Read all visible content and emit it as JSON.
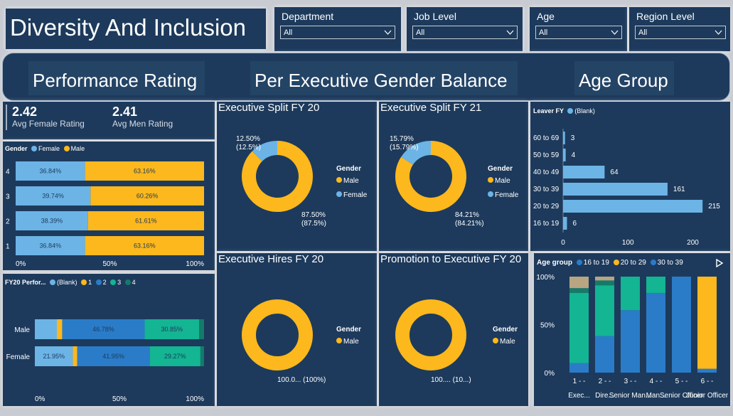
{
  "header": {
    "title": "Diversity And Inclusion"
  },
  "filters": [
    {
      "label": "Department",
      "value": "All"
    },
    {
      "label": "Job Level",
      "value": "All"
    },
    {
      "label": "Age",
      "value": "All"
    },
    {
      "label": "Region Level",
      "value": "All"
    }
  ],
  "nav": {
    "performance": "Performance Rating",
    "gender_balance": "Per Executive Gender Balance",
    "age_group": "Age Group"
  },
  "kpis": {
    "female_value": "2.42",
    "female_label": "Avg Female Rating",
    "male_value": "2.41",
    "male_label": "Avg Men Rating"
  },
  "colors": {
    "female": "#6cb4e6",
    "male": "#fcb81c",
    "blank": "#6cb4e6",
    "r1": "#fcb81c",
    "r2": "#2a7cc8",
    "r3": "#13b592",
    "r4": "#157a6a",
    "age_16_19": "#2a7cc8",
    "age_20_29": "#fcb81c",
    "age_30_39": "#13b592",
    "age_40_49": "#157a6a",
    "age_50_59": "#b8a582"
  },
  "chart_data": [
    {
      "id": "gender_rating",
      "type": "bar",
      "stacked": "100%",
      "orientation": "horizontal",
      "legend_title": "Gender",
      "categories": [
        "4",
        "3",
        "2",
        "1"
      ],
      "series": [
        {
          "name": "Female",
          "values": [
            36.84,
            39.74,
            38.39,
            36.84
          ],
          "labels": [
            "36.84%",
            "39.74%",
            "38.39%",
            "36.84%"
          ]
        },
        {
          "name": "Male",
          "values": [
            63.16,
            60.26,
            61.61,
            63.16
          ],
          "labels": [
            "63.16%",
            "60.26%",
            "61.61%",
            "63.16%"
          ]
        }
      ],
      "xticks": [
        "0%",
        "50%",
        "100%"
      ]
    },
    {
      "id": "fy20_performance",
      "type": "bar",
      "stacked": "100%",
      "orientation": "horizontal",
      "legend_title": "FY20 Perfor...",
      "categories": [
        "Male",
        "Female"
      ],
      "series": [
        {
          "name": "(Blank)",
          "values": [
            12.5,
            21.95
          ],
          "labels": [
            "",
            "21.95%"
          ]
        },
        {
          "name": "1",
          "values": [
            3.0,
            2.5
          ],
          "labels": [
            "",
            ""
          ]
        },
        {
          "name": "2",
          "values": [
            46.78,
            41.95
          ],
          "labels": [
            "46.78%",
            "41.95%"
          ]
        },
        {
          "name": "3",
          "values": [
            30.85,
            29.27
          ],
          "labels": [
            "30.85%",
            "29.27%"
          ]
        },
        {
          "name": "4",
          "values": [
            2.8,
            2.1
          ],
          "labels": [
            "",
            ""
          ]
        }
      ],
      "xticks": [
        "0%",
        "50%",
        "100%"
      ]
    },
    {
      "id": "exec_split_fy20",
      "type": "pie",
      "donut": true,
      "title": "Executive Split FY 20",
      "legend_title": "Gender",
      "legend": [
        "Male",
        "Female"
      ],
      "slices": [
        {
          "name": "Male",
          "value": 87.5,
          "label": "87.50%",
          "label2": "(87.5%)"
        },
        {
          "name": "Female",
          "value": 12.5,
          "label": "12.50%",
          "label2": "(12.5%)"
        }
      ]
    },
    {
      "id": "exec_split_fy21",
      "type": "pie",
      "donut": true,
      "title": "Executive Split FY 21",
      "legend_title": "Gender",
      "legend": [
        "Male",
        "Female"
      ],
      "slices": [
        {
          "name": "Male",
          "value": 84.21,
          "label": "84.21%",
          "label2": "(84.21%)"
        },
        {
          "name": "Female",
          "value": 15.79,
          "label": "15.79%",
          "label2": "(15.79%)"
        }
      ]
    },
    {
      "id": "exec_hires_fy20",
      "type": "pie",
      "donut": true,
      "title": "Executive Hires FY 20",
      "legend_title": "Gender",
      "legend": [
        "Male"
      ],
      "slices": [
        {
          "name": "Male",
          "value": 100,
          "label": "100.0... (100%)"
        }
      ]
    },
    {
      "id": "promotion_exec_fy20",
      "type": "pie",
      "donut": true,
      "title": "Promotion to Executive FY 20",
      "legend_title": "Gender",
      "legend": [
        "Male"
      ],
      "slices": [
        {
          "name": "Male",
          "value": 100,
          "label": "100.... (10...)"
        }
      ]
    },
    {
      "id": "leaver_fy",
      "type": "bar",
      "orientation": "horizontal",
      "legend_title": "Leaver FY",
      "legend": [
        "(Blank)"
      ],
      "categories": [
        "60 to 69",
        "50 to 59",
        "40 to 49",
        "30 to 39",
        "20 to 29",
        "16 to 19"
      ],
      "values": [
        3,
        4,
        64,
        161,
        215,
        6
      ],
      "xlim": [
        0,
        240
      ],
      "xticks": [
        0,
        100,
        200
      ]
    },
    {
      "id": "age_group",
      "type": "bar",
      "stacked": "100%",
      "legend_title": "Age group",
      "legend": [
        "16 to 19",
        "20 to 29",
        "30 to 39"
      ],
      "categories": [
        "1 - Exec...",
        "2 - Dire...",
        "3 - Senior Man...",
        "4 - Man...",
        "5 - Senior Officer",
        "6 - Junior Officer"
      ],
      "series": [
        {
          "name": "16 to 19",
          "values": [
            10,
            38,
            65,
            83,
            100,
            4
          ]
        },
        {
          "name": "20 to 29",
          "values": [
            0,
            0,
            0,
            0,
            0,
            96
          ]
        },
        {
          "name": "30 to 39",
          "values": [
            73,
            53,
            35,
            17,
            0,
            0
          ]
        },
        {
          "name": "40 to 49",
          "values": [
            5,
            5,
            0,
            0,
            0,
            0
          ]
        },
        {
          "name": "50 to 59",
          "values": [
            12,
            4,
            0,
            0,
            0,
            0
          ]
        }
      ],
      "yticks": [
        "100%",
        "50%",
        "0%"
      ]
    }
  ]
}
